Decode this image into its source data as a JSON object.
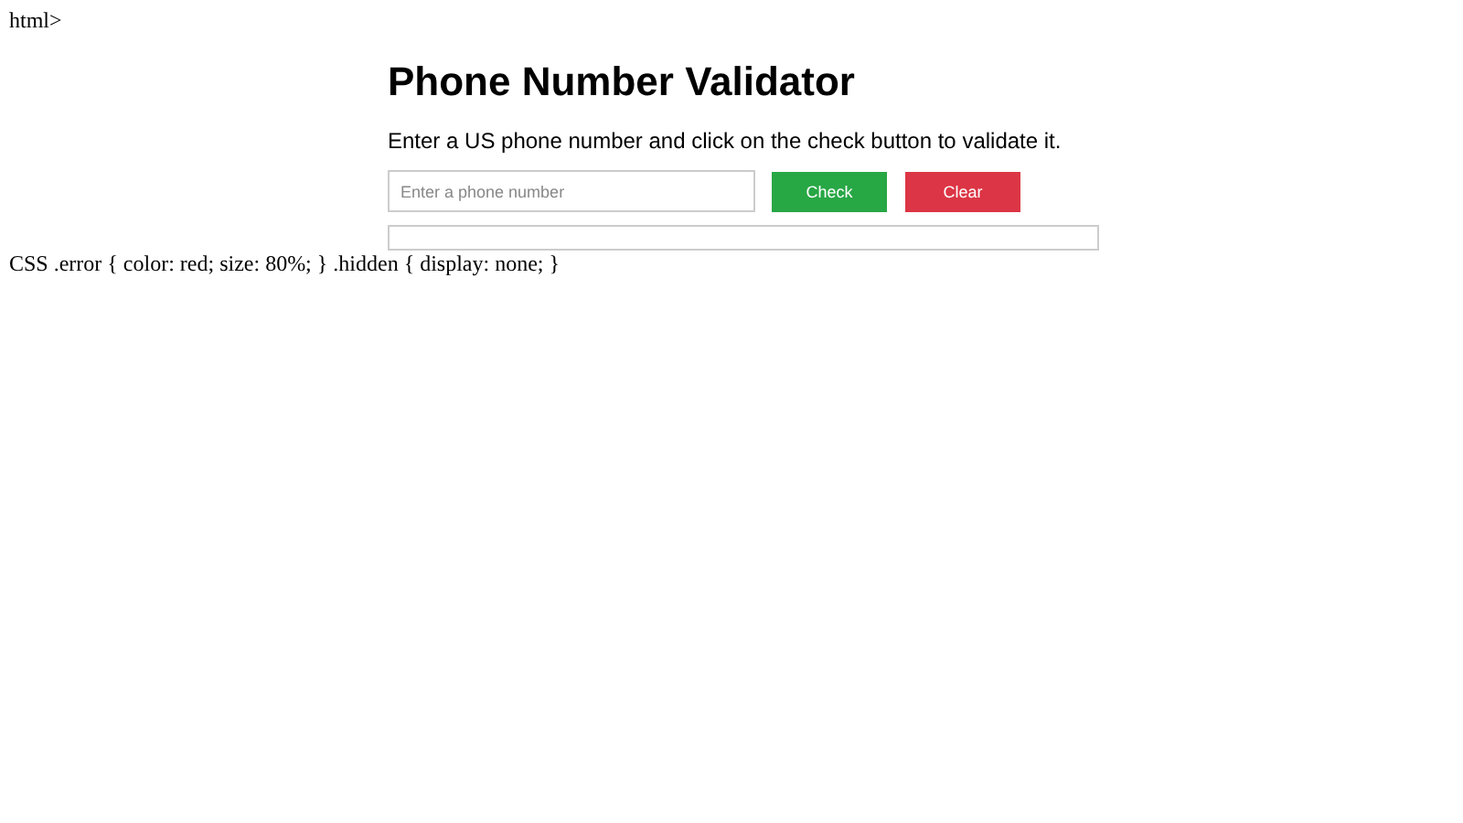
{
  "stray_text": "html>",
  "title": "Phone Number Validator",
  "instructions": "Enter a US phone number and click on the check button to validate it.",
  "phone_input": {
    "placeholder": "Enter a phone number"
  },
  "buttons": [
    {
      "label": "Check",
      "kind": "check"
    },
    {
      "label": "Clear",
      "kind": "clear"
    }
  ],
  "css_text": "CSS .error { color: red; size: 80%; } .hidden { display: none; }"
}
